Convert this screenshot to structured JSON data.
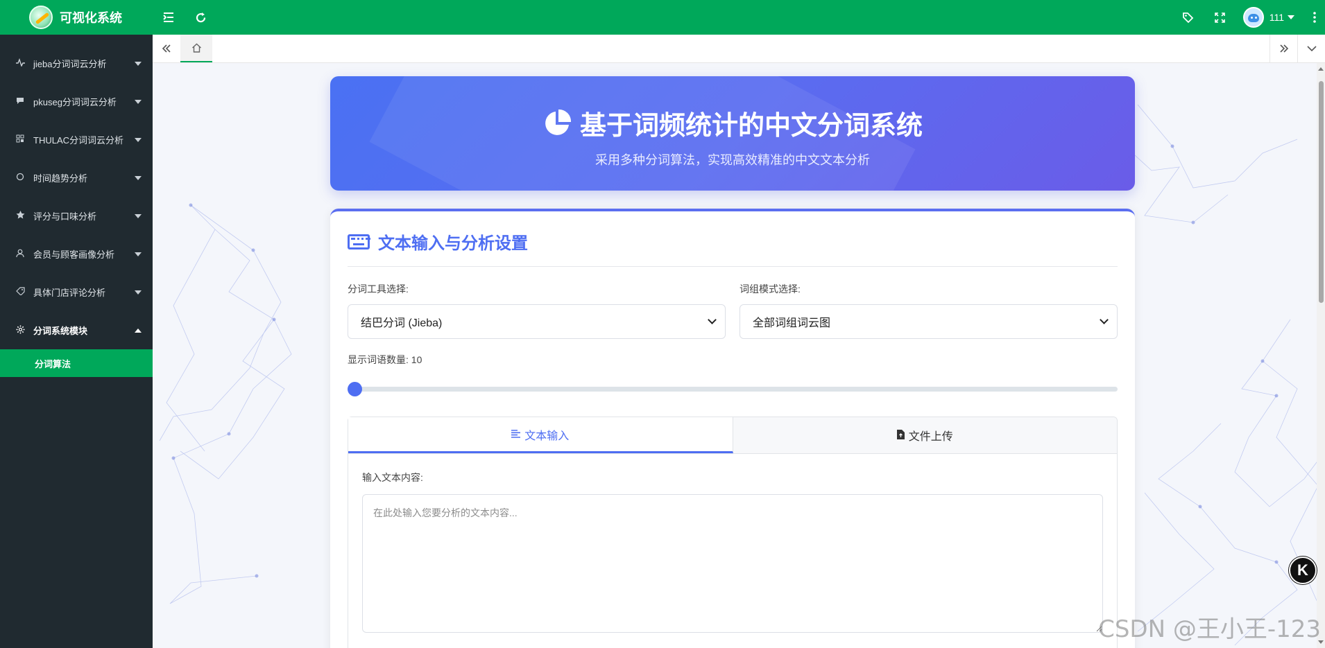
{
  "app": {
    "title": "可视化系统",
    "user_name": "111"
  },
  "sidebar": {
    "items": [
      {
        "label": "jieba分词词云分析",
        "icon": "pulse-icon"
      },
      {
        "label": "pkuseg分词词云分析",
        "icon": "comment-icon"
      },
      {
        "label": "THULAC分词词云分析",
        "icon": "grid-icon"
      },
      {
        "label": "时间趋势分析",
        "icon": "circle-icon"
      },
      {
        "label": "评分与口味分析",
        "icon": "star-icon"
      },
      {
        "label": "会员与顾客画像分析",
        "icon": "user-icon"
      },
      {
        "label": "具体门店评论分析",
        "icon": "tag-icon"
      },
      {
        "label": "分词系统模块",
        "icon": "gear-icon"
      }
    ],
    "sub_item": "分词算法"
  },
  "hero": {
    "title": "基于词频统计的中文分词系统",
    "subtitle": "采用多种分词算法，实现高效精准的中文文本分析"
  },
  "card": {
    "title": "文本输入与分析设置",
    "tool_label": "分词工具选择:",
    "tool_value": "结巴分词 (Jieba)",
    "mode_label": "词组模式选择:",
    "mode_value": "全部词组词云图",
    "count_label": "显示词语数量: 10",
    "count_value": 10,
    "tabs": [
      {
        "label": "文本输入"
      },
      {
        "label": "文件上传"
      }
    ],
    "textarea_label": "输入文本内容:",
    "textarea_placeholder": "在此处输入您要分析的文本内容..."
  },
  "badge": "K",
  "watermark": "CSDN @王小王-123",
  "colors": {
    "brand": "#00a85a",
    "sidebar": "#202a30",
    "accent": "#4e6ef2"
  }
}
